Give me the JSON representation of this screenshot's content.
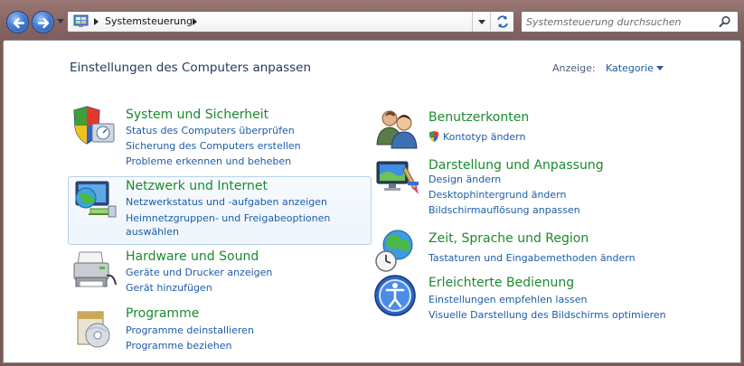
{
  "window": {
    "address": {
      "crumb": "Systemsteuerung"
    },
    "search": {
      "placeholder": "Systemsteuerung durchsuchen"
    }
  },
  "page": {
    "title": "Einstellungen des Computers anpassen",
    "view_label": "Anzeige:",
    "view_value": "Kategorie"
  },
  "categories": [
    {
      "title": "System und Sicherheit",
      "icon": "shield-icon",
      "links": [
        "Status des Computers überprüfen",
        "Sicherung des Computers erstellen",
        "Probleme erkennen und beheben"
      ]
    },
    {
      "title": "Netzwerk und Internet",
      "icon": "network-globe-icon",
      "links": [
        "Netzwerkstatus und -aufgaben anzeigen",
        "Heimnetzgruppen- und Freigabeoptionen",
        "auswählen"
      ]
    },
    {
      "title": "Hardware und Sound",
      "icon": "printer-icon",
      "links": [
        "Geräte und Drucker anzeigen",
        "Gerät hinzufügen"
      ]
    },
    {
      "title": "Programme",
      "icon": "programs-icon",
      "links": [
        "Programme deinstallieren",
        "Programme beziehen"
      ]
    },
    {
      "title": "Benutzerkonten",
      "icon": "users-icon",
      "links": [
        "Kontotyp ändern"
      ]
    },
    {
      "title": "Darstellung und Anpassung",
      "icon": "monitor-paint-icon",
      "links": [
        "Design ändern",
        "Desktophintergrund ändern",
        "Bildschirmauflösung anpassen"
      ]
    },
    {
      "title": "Zeit, Sprache und Region",
      "icon": "globe-clock-icon",
      "links": [
        "Tastaturen und Eingabemethoden ändern"
      ]
    },
    {
      "title": "Erleichterte Bedienung",
      "icon": "ease-of-access-icon",
      "links": [
        "Einstellungen empfehlen lassen",
        "Visuelle Darstellung des Bildschirms optimieren"
      ]
    }
  ],
  "colors": {
    "category_title": "#1b8a2e",
    "link": "#1c5ca8",
    "window_frame": "#8a6866"
  }
}
